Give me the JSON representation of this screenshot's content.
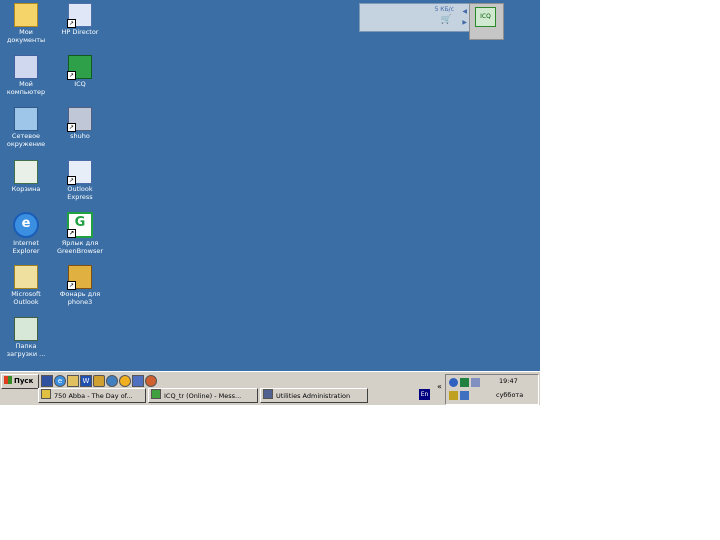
{
  "desktop": {
    "background_color": "#3a6ea5",
    "icons": [
      {
        "name": "my-documents-icon",
        "label": "Мои документы"
      },
      {
        "name": "my-computer-icon",
        "label": "Мой компьютер"
      },
      {
        "name": "network-icon",
        "label": "Сетевое окружение"
      },
      {
        "name": "recycle-bin-icon",
        "label": "Корзина"
      },
      {
        "name": "internet-explorer-icon",
        "label": "Internet Explorer"
      },
      {
        "name": "outlook-icon",
        "label": "Microsoft Outlook"
      },
      {
        "name": "hp-download-icon",
        "label": "Папка загрузки ..."
      },
      {
        "name": "hp-director-icon",
        "label": "HP Director"
      },
      {
        "name": "icq-icon",
        "label": "ICQ"
      },
      {
        "name": "shuffle-icon",
        "label": "shuho"
      },
      {
        "name": "outlook-express-icon",
        "label": "Outlook Express"
      },
      {
        "name": "greenbrowser-icon",
        "label": "Ярлык для GreenBrowser"
      },
      {
        "name": "phone-icon",
        "label": "Фонарь для phone3"
      }
    ]
  },
  "deskbar": {
    "status_text": "5 КБ/с",
    "logo_text": "ICQ"
  },
  "taskbar": {
    "start_label": "Пуск",
    "quick_launch": [
      "desktop-icon",
      "ie-icon",
      "outlook-icon",
      "word-icon",
      "gear-icon",
      "globe-icon",
      "media-icon",
      "browser-icon",
      "game-icon"
    ],
    "tasks": [
      {
        "label": "750 Abba - The Day of..."
      },
      {
        "label": "ICQ_tr (Online) - Mess..."
      },
      {
        "label": "Utilities Administration"
      }
    ],
    "language": "En",
    "chevron": "«",
    "clock_time": "19:47",
    "clock_day": "суббота"
  }
}
